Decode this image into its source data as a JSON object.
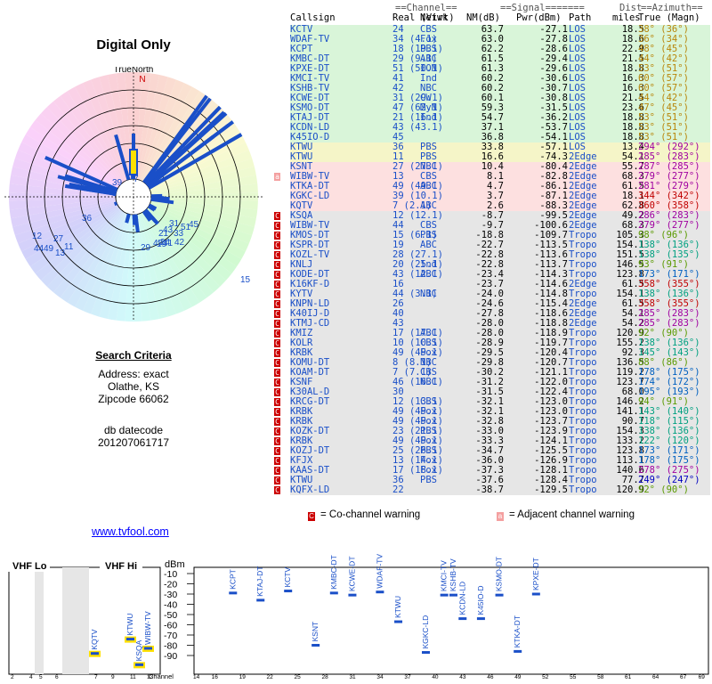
{
  "radar": {
    "title": "Digital Only",
    "true_north": "TrueNorth",
    "north_mark": "N",
    "ring_labels": [
      "7",
      "39",
      "36",
      "12",
      "27",
      "44",
      "49",
      "11",
      "13",
      "15",
      "31",
      "43",
      "21",
      "24",
      "29",
      "41",
      "47",
      "19",
      "45",
      "42",
      "51",
      "33"
    ]
  },
  "search": {
    "heading": "Search Criteria",
    "address": "Address: exact",
    "city": "Olathe, KS",
    "zip": "Zipcode 66062",
    "datecode_label": "db datecode",
    "datecode": "201207061717"
  },
  "link": "www.tvfool.com",
  "table_headers": {
    "line1": {
      "channel": "==Channel==",
      "signal": "==Signal=======",
      "dist": "Dist",
      "azimuth": "==Azimuth=="
    },
    "line2": {
      "callsign": "Callsign",
      "real": "Real (Virt)",
      "netwk": "Netwk",
      "nm": "NM(dB)",
      "pwr": "Pwr(dBm)",
      "path": "Path",
      "miles": "miles",
      "az": "True (Magn)"
    }
  },
  "stations": [
    {
      "cs": "KCTV",
      "ch": "24",
      "nw": "CBS",
      "nm": "63.7",
      "pw": "-27.1",
      "pa": "LOS",
      "mi": "18.5",
      "az": "38° (36°)",
      "bg": "#d9f5d9",
      "azc": "#b8860b"
    },
    {
      "cs": "WDAF-TV",
      "ch": "34 (4.1)",
      "nw": "Fox",
      "nm": "63.0",
      "pw": "-27.8",
      "pa": "LOS",
      "mi": "18.6",
      "az": "36° (34°)",
      "bg": "#d9f5d9",
      "azc": "#b8860b"
    },
    {
      "cs": "KCPT",
      "ch": "18 (19.1)",
      "nw": "PBS",
      "nm": "62.2",
      "pw": "-28.6",
      "pa": "LOS",
      "mi": "22.9",
      "az": "48° (45°)",
      "bg": "#d9f5d9",
      "azc": "#b8860b"
    },
    {
      "cs": "KMBC-DT",
      "ch": "29 (9.1)",
      "nw": "ABC",
      "nm": "61.5",
      "pw": "-29.4",
      "pa": "LOS",
      "mi": "21.5",
      "az": "44° (42°)",
      "bg": "#d9f5d9",
      "azc": "#b8860b"
    },
    {
      "cs": "KPXE-DT",
      "ch": "51 (50.1)",
      "nw": "ION",
      "nm": "61.3",
      "pw": "-29.6",
      "pa": "LOS",
      "mi": "18.8",
      "az": "53° (51°)",
      "bg": "#d9f5d9",
      "azc": "#b8860b"
    },
    {
      "cs": "KMCI-TV",
      "ch": "41",
      "nw": "Ind",
      "nm": "60.2",
      "pw": "-30.6",
      "pa": "LOS",
      "mi": "16.3",
      "az": "60° (57°)",
      "bg": "#d9f5d9",
      "azc": "#b8860b"
    },
    {
      "cs": "KSHB-TV",
      "ch": "42",
      "nw": "NBC",
      "nm": "60.2",
      "pw": "-30.7",
      "pa": "LOS",
      "mi": "16.3",
      "az": "60° (57°)",
      "bg": "#d9f5d9",
      "azc": "#b8860b"
    },
    {
      "cs": "KCWE-DT",
      "ch": "31 (29.1)",
      "nw": "CW",
      "nm": "60.1",
      "pw": "-30.8",
      "pa": "LOS",
      "mi": "21.5",
      "az": "44° (42°)",
      "bg": "#d9f5d9",
      "azc": "#b8860b"
    },
    {
      "cs": "KSMO-DT",
      "ch": "47 (62.1)",
      "nw": "MyN",
      "nm": "59.3",
      "pw": "-31.5",
      "pa": "LOS",
      "mi": "23.6",
      "az": "47° (45°)",
      "bg": "#d9f5d9",
      "azc": "#b8860b"
    },
    {
      "cs": "KTAJ-DT",
      "ch": "21 (16.1)",
      "nw": "Ind",
      "nm": "54.7",
      "pw": "-36.2",
      "pa": "LOS",
      "mi": "18.8",
      "az": "53° (51°)",
      "bg": "#d9f5d9",
      "azc": "#b8860b"
    },
    {
      "cs": "KCDN-LD",
      "ch": "43 (43.1)",
      "nw": "",
      "nm": "37.1",
      "pw": "-53.7",
      "pa": "LOS",
      "mi": "18.8",
      "az": "53° (51°)",
      "bg": "#d9f5d9",
      "azc": "#b8860b"
    },
    {
      "cs": "K45IO-D",
      "ch": "45",
      "nw": "",
      "nm": "36.8",
      "pw": "-54.1",
      "pa": "LOS",
      "mi": "18.8",
      "az": "53° (51°)",
      "bg": "#d9f5d9",
      "azc": "#b8860b"
    },
    {
      "cs": "KTWU",
      "ch": "36",
      "nw": "PBS",
      "nm": "33.8",
      "pw": "-57.1",
      "pa": "LOS",
      "mi": "13.4",
      "az": "294° (292°)",
      "bg": "#f5f5c8",
      "azc": "#a000a0"
    },
    {
      "cs": "KTWU",
      "ch": "11",
      "nw": "PBS",
      "nm": "16.6",
      "pw": "-74.3",
      "pa": "2Edge",
      "mi": "54.1",
      "az": "285° (283°)",
      "bg": "#f5f5c8",
      "azc": "#a000a0"
    },
    {
      "cs": "KSNT",
      "ch": "27 (27.1)",
      "nw": "NBC",
      "nm": "10.4",
      "pw": "-80.4",
      "pa": "2Edge",
      "mi": "55.7",
      "az": "287° (285°)",
      "bg": "#fde0e0",
      "azc": "#a000a0"
    },
    {
      "cs": "WIBW-TV",
      "ch": "13",
      "nw": "CBS",
      "nm": "8.1",
      "pw": "-82.8",
      "pa": "2Edge",
      "mi": "68.3",
      "az": "279° (277°)",
      "bg": "#fde0e0",
      "azc": "#a000a0",
      "warn": "adj"
    },
    {
      "cs": "KTKA-DT",
      "ch": "49 (49.1)",
      "nw": "ABC",
      "nm": "4.7",
      "pw": "-86.1",
      "pa": "2Edge",
      "mi": "61.5",
      "az": "281° (279°)",
      "bg": "#fde0e0",
      "azc": "#a000a0"
    },
    {
      "cs": "KGKC-LD",
      "ch": "39 (10.1)",
      "nw": "",
      "nm": "3.7",
      "pw": "-87.1",
      "pa": "2Edge",
      "mi": "18.1",
      "az": "344° (342°)",
      "bg": "#fde0e0",
      "azc": "#c00000"
    },
    {
      "cs": "KQTV",
      "ch": "7 (2.1)",
      "nw": "ABC",
      "nm": "2.6",
      "pw": "-88.3",
      "pa": "2Edge",
      "mi": "62.8",
      "az": "360° (358°)",
      "bg": "#fde0e0",
      "azc": "#c00000"
    },
    {
      "cs": "KSQA",
      "ch": "12 (12.1)",
      "nw": "",
      "nm": "-8.7",
      "pw": "-99.5",
      "pa": "2Edge",
      "mi": "49.2",
      "az": "286° (283°)",
      "bg": "#e6e6e6",
      "azc": "#a000a0",
      "warn": "co"
    },
    {
      "cs": "WIBW-TV",
      "ch": "44",
      "nw": "CBS",
      "nm": "-9.7",
      "pw": "-100.6",
      "pa": "2Edge",
      "mi": "68.3",
      "az": "279° (277°)",
      "bg": "#e6e6e6",
      "azc": "#a000a0",
      "warn": "co"
    },
    {
      "cs": "KMOS-DT",
      "ch": "15 (6.1)",
      "nw": "PBS",
      "nm": "-18.8",
      "pw": "-109.7",
      "pa": "Tropo",
      "mi": "105.3",
      "az": "98° (96°)",
      "bg": "#e6e6e6",
      "azc": "#5a9a00",
      "warn": "co"
    },
    {
      "cs": "KSPR-DT",
      "ch": "19",
      "nw": "ABC",
      "nm": "-22.7",
      "pw": "-113.5",
      "pa": "Tropo",
      "mi": "154.1",
      "az": "138° (136°)",
      "bg": "#e6e6e6",
      "azc": "#00a080",
      "warn": "co"
    },
    {
      "cs": "KOZL-TV",
      "ch": "28 (27.1)",
      "nw": "",
      "nm": "-22.8",
      "pw": "-113.6",
      "pa": "Tropo",
      "mi": "151.5",
      "az": "138° (135°)",
      "bg": "#e6e6e6",
      "azc": "#00a080",
      "warn": "co"
    },
    {
      "cs": "KNLJ",
      "ch": "20 (25.1)",
      "nw": "Ind",
      "nm": "-22.8",
      "pw": "-113.7",
      "pa": "Tropo",
      "mi": "146.5",
      "az": "93° (91°)",
      "bg": "#e6e6e6",
      "azc": "#5a9a00",
      "warn": "co"
    },
    {
      "cs": "KODE-DT",
      "ch": "43 (12.1)",
      "nw": "ABC",
      "nm": "-23.4",
      "pw": "-114.3",
      "pa": "Tropo",
      "mi": "123.8",
      "az": "173° (171°)",
      "bg": "#e6e6e6",
      "azc": "#0060c0",
      "warn": "co"
    },
    {
      "cs": "K16KF-D",
      "ch": "16",
      "nw": "",
      "nm": "-23.7",
      "pw": "-114.6",
      "pa": "2Edge",
      "mi": "61.5",
      "az": "358° (355°)",
      "bg": "#e6e6e6",
      "azc": "#c00000",
      "warn": "co"
    },
    {
      "cs": "KYTV",
      "ch": "44 (3.1)",
      "nw": "NBC",
      "nm": "-24.0",
      "pw": "-114.8",
      "pa": "Tropo",
      "mi": "154.1",
      "az": "138° (136°)",
      "bg": "#e6e6e6",
      "azc": "#00a080",
      "warn": "co"
    },
    {
      "cs": "KNPN-LD",
      "ch": "26",
      "nw": "",
      "nm": "-24.6",
      "pw": "-115.4",
      "pa": "2Edge",
      "mi": "61.5",
      "az": "358° (355°)",
      "bg": "#e6e6e6",
      "azc": "#c00000",
      "warn": "co"
    },
    {
      "cs": "K40IJ-D",
      "ch": "40",
      "nw": "",
      "nm": "-27.8",
      "pw": "-118.6",
      "pa": "2Edge",
      "mi": "54.1",
      "az": "285° (283°)",
      "bg": "#e6e6e6",
      "azc": "#a000a0",
      "warn": "co"
    },
    {
      "cs": "KTMJ-CD",
      "ch": "43",
      "nw": "",
      "nm": "-28.0",
      "pw": "-118.8",
      "pa": "2Edge",
      "mi": "54.2",
      "az": "285° (283°)",
      "bg": "#e6e6e6",
      "azc": "#a000a0",
      "warn": "co"
    },
    {
      "cs": "KMIZ",
      "ch": "17 (17.1)",
      "nw": "ABC",
      "nm": "-28.0",
      "pw": "-118.9",
      "pa": "Tropo",
      "mi": "120.9",
      "az": "92° (90°)",
      "bg": "#e6e6e6",
      "azc": "#5a9a00",
      "warn": "co"
    },
    {
      "cs": "KOLR",
      "ch": "10 (10.1)",
      "nw": "CBS",
      "nm": "-28.9",
      "pw": "-119.7",
      "pa": "Tropo",
      "mi": "155.2",
      "az": "138° (136°)",
      "bg": "#e6e6e6",
      "azc": "#00a080",
      "warn": "co"
    },
    {
      "cs": "KRBK",
      "ch": "49 (49.1)",
      "nw": "Fox",
      "nm": "-29.5",
      "pw": "-120.4",
      "pa": "Tropo",
      "mi": "92.3",
      "az": "145° (143°)",
      "bg": "#e6e6e6",
      "azc": "#00a080",
      "warn": "co"
    },
    {
      "cs": "KOMU-DT",
      "ch": "8 (8.1)",
      "nw": "NBC",
      "nm": "-29.8",
      "pw": "-120.7",
      "pa": "Tropo",
      "mi": "136.5",
      "az": "88° (86°)",
      "bg": "#e6e6e6",
      "azc": "#5a9a00",
      "warn": "co"
    },
    {
      "cs": "KOAM-DT",
      "ch": "7 (7.1)",
      "nw": "CBS",
      "nm": "-30.2",
      "pw": "-121.1",
      "pa": "Tropo",
      "mi": "119.2",
      "az": "178° (175°)",
      "bg": "#e6e6e6",
      "azc": "#0060c0",
      "warn": "co"
    },
    {
      "cs": "KSNF",
      "ch": "46 (16.1)",
      "nw": "NBC",
      "nm": "-31.2",
      "pw": "-122.0",
      "pa": "Tropo",
      "mi": "123.7",
      "az": "174° (172°)",
      "bg": "#e6e6e6",
      "azc": "#0060c0",
      "warn": "co"
    },
    {
      "cs": "K30AL-D",
      "ch": "30",
      "nw": "",
      "nm": "-31.5",
      "pw": "-122.4",
      "pa": "Tropo",
      "mi": "68.0",
      "az": "195° (193°)",
      "bg": "#e6e6e6",
      "azc": "#0060c0",
      "warn": "co"
    },
    {
      "cs": "KRCG-DT",
      "ch": "12 (13.1)",
      "nw": "CBS",
      "nm": "-32.1",
      "pw": "-123.0",
      "pa": "Tropo",
      "mi": "146.2",
      "az": "94° (91°)",
      "bg": "#e6e6e6",
      "azc": "#5a9a00",
      "warn": "co"
    },
    {
      "cs": "KRBK",
      "ch": "49 (49.1)",
      "nw": "Fox",
      "nm": "-32.1",
      "pw": "-123.0",
      "pa": "Tropo",
      "mi": "141.1",
      "az": "143° (140°)",
      "bg": "#e6e6e6",
      "azc": "#00a080",
      "warn": "co"
    },
    {
      "cs": "KRBK",
      "ch": "49 (49.1)",
      "nw": "Fox",
      "nm": "-32.8",
      "pw": "-123.7",
      "pa": "Tropo",
      "mi": "90.7",
      "az": "118° (115°)",
      "bg": "#e6e6e6",
      "azc": "#00a080",
      "warn": "co"
    },
    {
      "cs": "KOZK-DT",
      "ch": "23 (21.1)",
      "nw": "PBS",
      "nm": "-33.0",
      "pw": "-123.9",
      "pa": "Tropo",
      "mi": "154.3",
      "az": "138° (136°)",
      "bg": "#e6e6e6",
      "azc": "#00a080",
      "warn": "co"
    },
    {
      "cs": "KRBK",
      "ch": "49 (49.1)",
      "nw": "Fox",
      "nm": "-33.3",
      "pw": "-124.1",
      "pa": "Tropo",
      "mi": "133.2",
      "az": "122° (120°)",
      "bg": "#e6e6e6",
      "azc": "#00a080",
      "warn": "co"
    },
    {
      "cs": "KOZJ-DT",
      "ch": "25 (26.1)",
      "nw": "PBS",
      "nm": "-34.7",
      "pw": "-125.5",
      "pa": "Tropo",
      "mi": "123.8",
      "az": "173° (171°)",
      "bg": "#e6e6e6",
      "azc": "#0060c0",
      "warn": "co"
    },
    {
      "cs": "KFJX",
      "ch": "13 (14.1)",
      "nw": "Fox",
      "nm": "-36.0",
      "pw": "-126.9",
      "pa": "Tropo",
      "mi": "113.1",
      "az": "178° (175°)",
      "bg": "#e6e6e6",
      "azc": "#0060c0",
      "warn": "co"
    },
    {
      "cs": "KAAS-DT",
      "ch": "17 (18.1)",
      "nw": "Fox",
      "nm": "-37.3",
      "pw": "-128.1",
      "pa": "Tropo",
      "mi": "140.6",
      "az": "278° (275°)",
      "bg": "#e6e6e6",
      "azc": "#a000a0",
      "warn": "co"
    },
    {
      "cs": "KTWU",
      "ch": "36",
      "nw": "PBS",
      "nm": "-37.6",
      "pw": "-128.4",
      "pa": "Tropo",
      "mi": "77.7",
      "az": "249° (247°)",
      "bg": "#e6e6e6",
      "azc": "#0000c0",
      "warn": "co"
    },
    {
      "cs": "KQFX-LD",
      "ch": "22",
      "nw": "",
      "nm": "-38.7",
      "pw": "-129.5",
      "pa": "Tropo",
      "mi": "120.9",
      "az": "92° (90°)",
      "bg": "#e6e6e6",
      "azc": "#5a9a00",
      "warn": "co"
    }
  ],
  "legend": {
    "co_mark": "C",
    "co": "= Co-channel warning",
    "adj_mark": "a",
    "adj": "= Adjacent channel warning"
  },
  "band": {
    "vhf_lo": "VHF Lo",
    "vhf_hi": "VHF Hi",
    "dbm": "dBm",
    "channel_label": "Channel",
    "y_ticks": [
      "-10",
      "-20",
      "-30",
      "-40",
      "-50",
      "-60",
      "-70",
      "-80",
      "-90"
    ],
    "lo_ticks": [
      "2",
      "4",
      "5",
      "6"
    ],
    "hi_ticks": [
      "7",
      "9",
      "11",
      "13"
    ],
    "uhf_ticks": [
      "14",
      "16",
      "19",
      "22",
      "25",
      "28",
      "31",
      "34",
      "37",
      "40",
      "43",
      "46",
      "49",
      "52",
      "55",
      "58",
      "61",
      "64",
      "67",
      "69"
    ],
    "stations": [
      {
        "name": "KQTV",
        "ch": 7,
        "dbm": -88,
        "band": "hi",
        "sel": true
      },
      {
        "name": "KTWU",
        "ch": 11,
        "dbm": -74,
        "band": "hi",
        "sel": true
      },
      {
        "name": "WIBW-TV",
        "ch": 13,
        "dbm": -83,
        "band": "hi",
        "sel": true
      },
      {
        "name": "KSQA",
        "ch": 12,
        "dbm": -99,
        "band": "hi",
        "sel": true
      },
      {
        "name": "KCPT",
        "ch": 18,
        "dbm": -29,
        "band": "uhf"
      },
      {
        "name": "KTAJ-DT",
        "ch": 21,
        "dbm": -36,
        "band": "uhf"
      },
      {
        "name": "KCTV",
        "ch": 24,
        "dbm": -27,
        "band": "uhf"
      },
      {
        "name": "KSNT",
        "ch": 27,
        "dbm": -80,
        "band": "uhf"
      },
      {
        "name": "KMBC-DT",
        "ch": 29,
        "dbm": -29,
        "band": "uhf"
      },
      {
        "name": "KCWE-DT",
        "ch": 31,
        "dbm": -31,
        "band": "uhf"
      },
      {
        "name": "WDAF-TV",
        "ch": 34,
        "dbm": -28,
        "band": "uhf"
      },
      {
        "name": "KTWU",
        "ch": 36,
        "dbm": -57,
        "band": "uhf"
      },
      {
        "name": "KGKC-LD",
        "ch": 39,
        "dbm": -87,
        "band": "uhf"
      },
      {
        "name": "KMCI-TV",
        "ch": 41,
        "dbm": -31,
        "band": "uhf"
      },
      {
        "name": "KSHB-TV",
        "ch": 42,
        "dbm": -31,
        "band": "uhf"
      },
      {
        "name": "KCDN-LD",
        "ch": 43,
        "dbm": -54,
        "band": "uhf"
      },
      {
        "name": "K45IO-D",
        "ch": 45,
        "dbm": -54,
        "band": "uhf"
      },
      {
        "name": "KSMO-DT",
        "ch": 47,
        "dbm": -31,
        "band": "uhf"
      },
      {
        "name": "KTKA-DT",
        "ch": 49,
        "dbm": -86,
        "band": "uhf"
      },
      {
        "name": "KPXE-DT",
        "ch": 51,
        "dbm": -30,
        "band": "uhf"
      }
    ]
  }
}
